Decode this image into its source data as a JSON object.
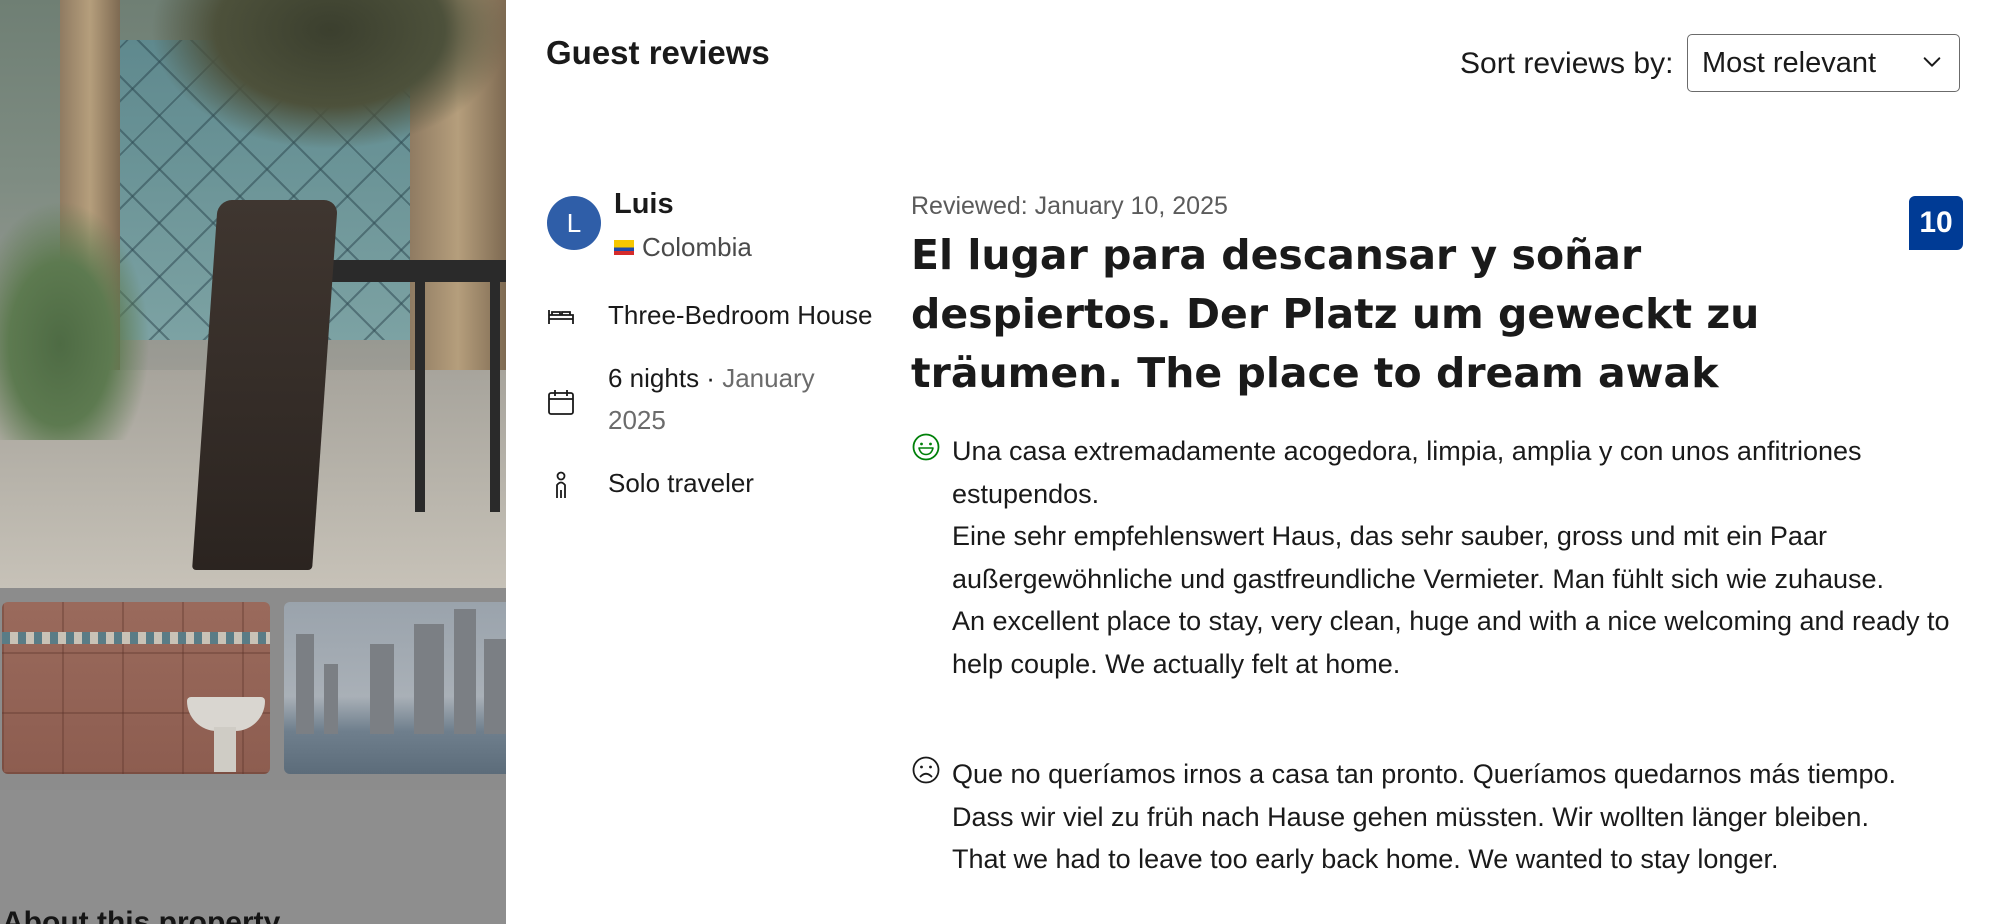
{
  "gallery": {
    "main_photo": "patio with chair and table",
    "thumbnails": [
      "bathroom sink",
      "city skyline by the water"
    ],
    "bottom_heading": "About this property"
  },
  "drawer": {
    "title": "Guest reviews",
    "sort": {
      "label": "Sort reviews by:",
      "selected": "Most relevant"
    }
  },
  "review": {
    "reviewer": {
      "initial": "L",
      "name": "Luis",
      "country": "Colombia",
      "room": "Three-Bedroom House",
      "stay_nights": "6 nights ·",
      "stay_date": "January",
      "stay_year": "2025",
      "traveler_type": "Solo traveler"
    },
    "reviewed_date": "Reviewed: January 10, 2025",
    "score": "10",
    "headline": "El lugar para descansar y soñar despiertos. Der Platz um geweckt zu träumen. The place to dream awak",
    "liked": "Una casa extremadamente acogedora, limpia, amplia y con unos anfitriones estupendos.\nEine sehr empfehlenswert Haus, das sehr sauber, gross und mit ein Paar außergewöhnliche und gastfreundliche Vermieter. Man fühlt sich wie zuhause.\nAn excellent place to stay, very clean, huge and with a nice welcoming and ready to help couple. We actually felt at home.",
    "disliked": "Que no queríamos irnos a casa tan pronto. Queríamos quedarnos más tiempo.\nDass wir viel zu früh nach Hause gehen müssten. Wir wollten länger bleiben.\nThat we had to leave too early back home. We wanted to stay longer."
  }
}
